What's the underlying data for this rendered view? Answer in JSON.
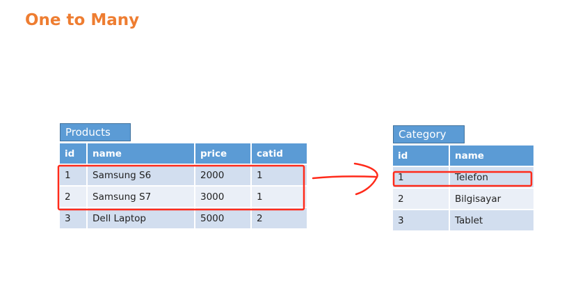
{
  "slide": {
    "title": "One to Many"
  },
  "products": {
    "label": "Products",
    "columns": [
      "id",
      "name",
      "price",
      "catid"
    ],
    "rows": [
      [
        "1",
        "Samsung S6",
        "2000",
        "1"
      ],
      [
        "2",
        "Samsung S7",
        "3000",
        "1"
      ],
      [
        "3",
        "Dell Laptop",
        "5000",
        "2"
      ]
    ]
  },
  "category": {
    "label": "Category",
    "columns": [
      "id",
      "name"
    ],
    "rows": [
      [
        "1",
        "Telefon"
      ],
      [
        "2",
        "Bilgisayar"
      ],
      [
        "3",
        "Tablet"
      ]
    ]
  },
  "colors": {
    "title": "#ee7d31",
    "header": "#5b9bd5",
    "row_odd": "#d2deef",
    "row_even": "#eaeff7",
    "highlight": "#ff2a1a"
  }
}
